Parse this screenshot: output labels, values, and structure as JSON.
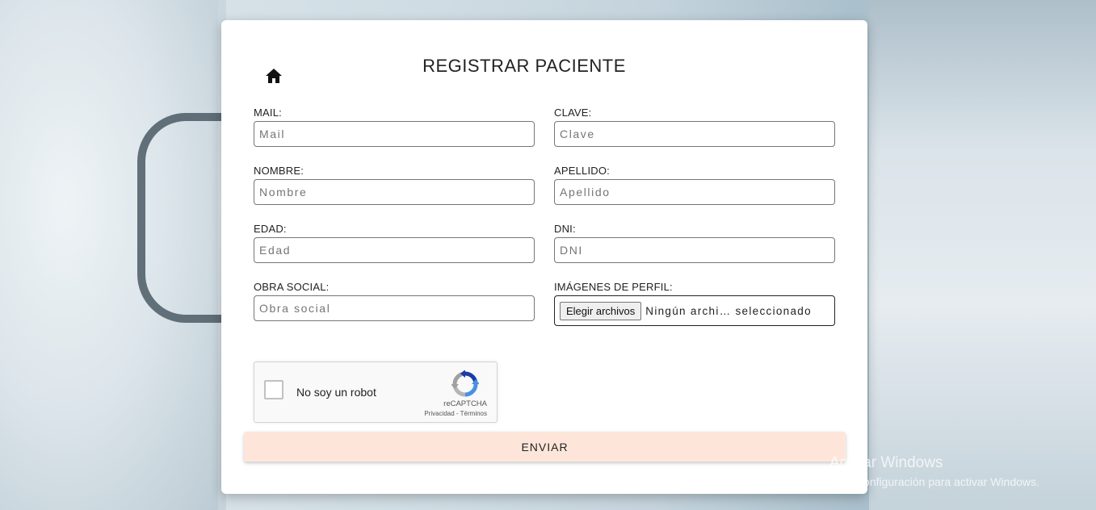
{
  "form": {
    "title": "REGISTRAR PACIENTE",
    "home_icon": "home-icon",
    "fields": {
      "mail": {
        "label": "MAIL:",
        "placeholder": "Mail"
      },
      "clave": {
        "label": "CLAVE:",
        "placeholder": "Clave"
      },
      "nombre": {
        "label": "NOMBRE:",
        "placeholder": "Nombre"
      },
      "apellido": {
        "label": "APELLIDO:",
        "placeholder": "Apellido"
      },
      "edad": {
        "label": "EDAD:",
        "placeholder": "Edad"
      },
      "dni": {
        "label": "DNI:",
        "placeholder": "DNI"
      },
      "obra_social": {
        "label": "OBRA SOCIAL:",
        "placeholder": "Obra social"
      },
      "imagenes": {
        "label": "IMÁGENES DE PERFIL:",
        "button": "Elegir archivos",
        "status": "Ningún archi… seleccionado"
      }
    },
    "captcha": {
      "label": "No soy un robot",
      "brand": "reCAPTCHA",
      "links": "Privacidad - Términos"
    },
    "submit_label": "ENVIAR"
  },
  "watermark": {
    "title": "Activar Windows",
    "subtitle": "Ve a Configuración para activar Windows."
  },
  "colors": {
    "card": "#ffffff",
    "submit_bg": "#fde6d9",
    "text": "#222222"
  }
}
